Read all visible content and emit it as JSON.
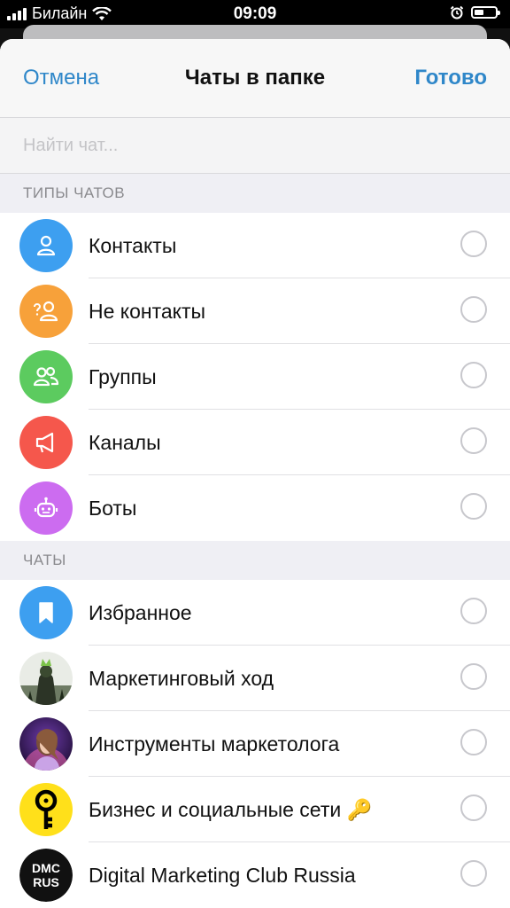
{
  "status": {
    "carrier": "Билайн",
    "time": "09:09",
    "battery_level": 0.45
  },
  "nav": {
    "cancel_label": "Отмена",
    "title": "Чаты в папке",
    "done_label": "Готово"
  },
  "search": {
    "placeholder": "Найти чат..."
  },
  "sections": {
    "chat_types": {
      "header": "ТИПЫ ЧАТОВ",
      "items": [
        {
          "label": "Контакты",
          "icon": "person-icon",
          "color": "#3d9ff0"
        },
        {
          "label": "Не контакты",
          "icon": "person-question-icon",
          "color": "#f7a13a"
        },
        {
          "label": "Группы",
          "icon": "people-icon",
          "color": "#5ccb5f"
        },
        {
          "label": "Каналы",
          "icon": "megaphone-icon",
          "color": "#f5574c"
        },
        {
          "label": "Боты",
          "icon": "robot-icon",
          "color": "#cc6cf0"
        }
      ]
    },
    "chats": {
      "header": "ЧАТЫ",
      "items": [
        {
          "label": "Избранное",
          "icon": "bookmark-icon",
          "color": "#3d9ff0"
        },
        {
          "label": "Маркетинговый ход",
          "icon": "chat-avatar"
        },
        {
          "label": "Инструменты маркетолога",
          "icon": "chat-avatar"
        },
        {
          "label": "Бизнес и социальные сети 🔑",
          "icon": "key-logo-icon",
          "color": "#ffe01a"
        },
        {
          "label": "Digital Marketing Club Russia",
          "icon": "dmc-logo-icon",
          "logo_text_top": "DMC",
          "logo_text_bottom": "RUS"
        }
      ]
    }
  }
}
